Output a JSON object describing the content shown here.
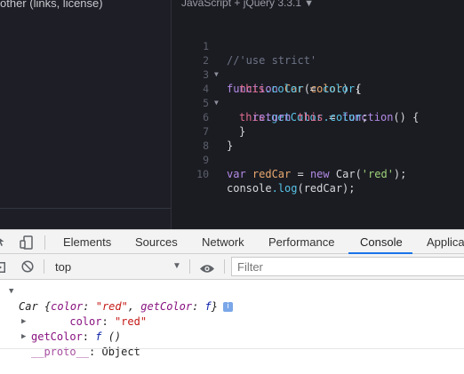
{
  "left_panel": {
    "text": "other (links, license)"
  },
  "editor": {
    "title": "JavaScript + jQuery 3.3.1",
    "title_caret": "▼",
    "line_numbers": [
      "1",
      "2",
      "3",
      "4",
      "5",
      "6",
      "7",
      "8",
      "9",
      "10"
    ],
    "lines": {
      "l1": {
        "comment": "//'use strict'"
      },
      "l2": {
        "kw": "function",
        "fn": "Car",
        "p1": "(",
        "arg": "color",
        "p2": ") {"
      },
      "l3": {
        "this": "this",
        "prop": ".color",
        "eq": " = ",
        "val": "color",
        "end": ";"
      },
      "l4": {
        "this": "this",
        "prop": ".getColor",
        "eq": " = ",
        "kw": "function",
        "end": "() {"
      },
      "l5": {
        "kw": "return",
        "sp": " ",
        "this": "this",
        "prop": ".color",
        "end": ";"
      },
      "l6": {
        "text": "}"
      },
      "l7": {
        "text": "}"
      },
      "l9": {
        "kw": "var",
        "name": " redCar",
        "eq": " = ",
        "new": "new",
        "sp": " ",
        "cls": "Car",
        "p1": "(",
        "str": "'red'",
        "end": ");"
      },
      "l10": {
        "obj": "console",
        "prop": ".log",
        "end": "(redCar);"
      }
    }
  },
  "devtools": {
    "tabs": [
      "Elements",
      "Sources",
      "Network",
      "Performance",
      "Console",
      "Application"
    ],
    "active_tab": "Console",
    "context": "top",
    "context_arrow": "▼",
    "filter_placeholder": "Filter",
    "accent": "#1a73e8"
  },
  "console": {
    "summary": {
      "cls": "Car",
      "open": " {",
      "k1": "color",
      "colon1": ": ",
      "v1": "\"red\"",
      "comma": ", ",
      "k2": "getColor",
      "colon2": ": ",
      "v2": "f",
      "close": "}",
      "info": "i"
    },
    "prop_color": {
      "key": "color",
      "colon": ": ",
      "value": "\"red\""
    },
    "prop_getcolor": {
      "key": "getColor",
      "colon": ": ",
      "f": "f",
      "args": " ()"
    },
    "prop_proto": {
      "key": "__proto__",
      "colon": ": ",
      "value": "Object"
    }
  }
}
